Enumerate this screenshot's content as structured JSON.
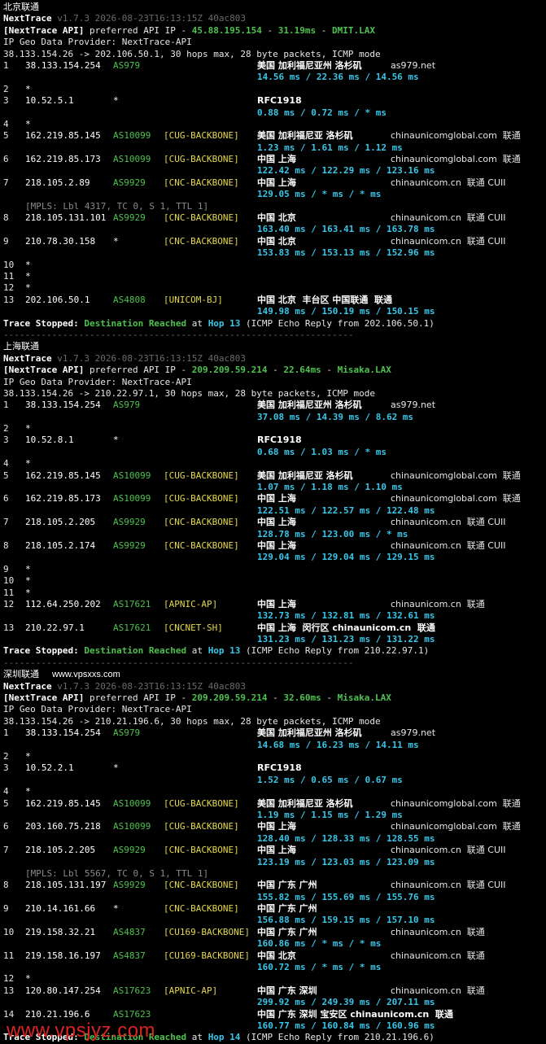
{
  "sections": [
    {
      "title": "北京联通",
      "site": "",
      "version_line": {
        "app": "NextTrace",
        "meta": "v1.7.3 2026-08-23T16:13:15Z 40ac803"
      },
      "api_line": {
        "prefix": "[NextTrace API]",
        "text": " preferred API IP - ",
        "ip": "45.88.195.154",
        "dash": " - ",
        "ms": "31.19ms",
        "dash2": " - ",
        "node": "DMIT.LAX"
      },
      "geo_provider": "IP Geo Data Provider: NextTrace-API",
      "route_line": "38.133.154.26 -> 202.106.50.1, 30 hops max, 28 byte packets, ICMP mode",
      "hops": [
        {
          "n": "1",
          "ip": "38.133.154.254",
          "as": "AS979",
          "tag": "",
          "geo": "美国 加利福尼亚州 洛杉矶",
          "dom": "as979.net",
          "rtt": "14.56 ms / 22.36 ms / 14.56 ms"
        },
        {
          "n": "2",
          "ip": "*"
        },
        {
          "n": "3",
          "ip": "10.52.5.1",
          "as": "*",
          "tag": "",
          "geo": "RFC1918",
          "dom": "",
          "rtt": "0.88 ms / 0.72 ms / * ms"
        },
        {
          "n": "4",
          "ip": "*"
        },
        {
          "n": "5",
          "ip": "162.219.85.145",
          "as": "AS10099",
          "tag": "[CUG-BACKBONE]",
          "geo": "美国 加利福尼亚 洛杉矶",
          "dom": "chinaunicomglobal.com  联通",
          "rtt": "1.23 ms / 1.61 ms / 1.12 ms"
        },
        {
          "n": "6",
          "ip": "162.219.85.173",
          "as": "AS10099",
          "tag": "[CUG-BACKBONE]",
          "geo": "中国 上海",
          "dom": "chinaunicomglobal.com  联通",
          "rtt": "122.42 ms / 122.29 ms / 123.16 ms"
        },
        {
          "n": "7",
          "ip": "218.105.2.89",
          "as": "AS9929",
          "tag": "[CNC-BACKBONE]",
          "geo": "中国 上海",
          "dom": "chinaunicom.cn  联通 CUII",
          "rtt": "129.05 ms / * ms / * ms"
        },
        {
          "n": "8",
          "ip": "218.105.131.101",
          "as": "AS9929",
          "tag": "[CNC-BACKBONE]",
          "geo": "中国 北京",
          "dom": "chinaunicom.cn  联通 CUII",
          "rtt": "163.40 ms / 163.41 ms / 163.78 ms",
          "mpls": "[MPLS: Lbl 4317, TC 0, S 1, TTL 1]"
        },
        {
          "n": "9",
          "ip": "210.78.30.158",
          "as": "*",
          "tag": "[CNC-BACKBONE]",
          "geo": "中国 北京",
          "dom": "chinaunicom.cn  联通 CUII",
          "rtt": "153.83 ms / 153.13 ms / 152.96 ms"
        },
        {
          "n": "10",
          "ip": "*"
        },
        {
          "n": "11",
          "ip": "*"
        },
        {
          "n": "12",
          "ip": "*"
        },
        {
          "n": "13",
          "ip": "202.106.50.1",
          "as": "AS4808",
          "tag": "[UNICOM-BJ]",
          "geo": "中国 北京  丰台区 中国联通  联通",
          "dom": "",
          "rtt": "149.98 ms / 150.19 ms / 150.15 ms"
        }
      ],
      "stop": {
        "a": "Trace Stopped: ",
        "b": "Destination Reached",
        "c": " at ",
        "d": "Hop 13",
        "e": " (ICMP Echo Reply from 202.106.50.1)"
      }
    },
    {
      "title": "上海联通",
      "site": "",
      "version_line": {
        "app": "NextTrace",
        "meta": "v1.7.3 2026-08-23T16:13:15Z 40ac803"
      },
      "api_line": {
        "prefix": "[NextTrace API]",
        "text": " preferred API IP - ",
        "ip": "209.209.59.214",
        "dash": " - ",
        "ms": "22.64ms",
        "dash2": " - ",
        "node": "Misaka.LAX"
      },
      "geo_provider": "IP Geo Data Provider: NextTrace-API",
      "route_line": "38.133.154.26 -> 210.22.97.1, 30 hops max, 28 byte packets, ICMP mode",
      "hops": [
        {
          "n": "1",
          "ip": "38.133.154.254",
          "as": "AS979",
          "tag": "",
          "geo": "美国 加利福尼亚州 洛杉矶",
          "dom": "as979.net",
          "rtt": "37.08 ms / 14.39 ms / 8.62 ms"
        },
        {
          "n": "2",
          "ip": "*"
        },
        {
          "n": "3",
          "ip": "10.52.8.1",
          "as": "*",
          "tag": "",
          "geo": "RFC1918",
          "dom": "",
          "rtt": "0.68 ms / 1.03 ms / * ms"
        },
        {
          "n": "4",
          "ip": "*"
        },
        {
          "n": "5",
          "ip": "162.219.85.145",
          "as": "AS10099",
          "tag": "[CUG-BACKBONE]",
          "geo": "美国 加利福尼亚 洛杉矶",
          "dom": "chinaunicomglobal.com  联通",
          "rtt": "1.07 ms / 1.18 ms / 1.10 ms"
        },
        {
          "n": "6",
          "ip": "162.219.85.173",
          "as": "AS10099",
          "tag": "[CUG-BACKBONE]",
          "geo": "中国 上海",
          "dom": "chinaunicomglobal.com  联通",
          "rtt": "122.51 ms / 122.57 ms / 122.48 ms"
        },
        {
          "n": "7",
          "ip": "218.105.2.205",
          "as": "AS9929",
          "tag": "[CNC-BACKBONE]",
          "geo": "中国 上海",
          "dom": "chinaunicom.cn  联通 CUII",
          "rtt": "128.78 ms / 123.00 ms / * ms"
        },
        {
          "n": "8",
          "ip": "218.105.2.174",
          "as": "AS9929",
          "tag": "[CNC-BACKBONE]",
          "geo": "中国 上海",
          "dom": "chinaunicom.cn  联通 CUII",
          "rtt": "129.04 ms / 129.04 ms / 129.15 ms"
        },
        {
          "n": "9",
          "ip": "*"
        },
        {
          "n": "10",
          "ip": "*"
        },
        {
          "n": "11",
          "ip": "*"
        },
        {
          "n": "12",
          "ip": "112.64.250.202",
          "as": "AS17621",
          "tag": "[APNIC-AP]",
          "geo": "中国 上海",
          "dom": "chinaunicom.cn  联通",
          "rtt": "132.73 ms / 132.81 ms / 132.61 ms"
        },
        {
          "n": "13",
          "ip": "210.22.97.1",
          "as": "AS17621",
          "tag": "[CNCNET-SH]",
          "geo": "中国 上海  闵行区 chinaunicom.cn  联通",
          "dom": "",
          "rtt": "131.23 ms / 131.23 ms / 131.22 ms"
        }
      ],
      "stop": {
        "a": "Trace Stopped: ",
        "b": "Destination Reached",
        "c": " at ",
        "d": "Hop 13",
        "e": " (ICMP Echo Reply from 210.22.97.1)"
      }
    },
    {
      "title": "深圳联通",
      "site": "www.vpsxxs.com",
      "version_line": {
        "app": "NextTrace",
        "meta": "v1.7.3 2026-08-23T16:13:15Z 40ac803"
      },
      "api_line": {
        "prefix": "[NextTrace API]",
        "text": " preferred API IP - ",
        "ip": "209.209.59.214",
        "dash": " - ",
        "ms": "32.60ms",
        "dash2": " - ",
        "node": "Misaka.LAX"
      },
      "geo_provider": "IP Geo Data Provider: NextTrace-API",
      "route_line": "38.133.154.26 -> 210.21.196.6, 30 hops max, 28 byte packets, ICMP mode",
      "hops": [
        {
          "n": "1",
          "ip": "38.133.154.254",
          "as": "AS979",
          "tag": "",
          "geo": "美国 加利福尼亚州 洛杉矶",
          "dom": "as979.net",
          "rtt": "14.68 ms / 16.23 ms / 14.11 ms"
        },
        {
          "n": "2",
          "ip": "*"
        },
        {
          "n": "3",
          "ip": "10.52.2.1",
          "as": "*",
          "tag": "",
          "geo": "RFC1918",
          "dom": "",
          "rtt": "1.52 ms / 0.65 ms / 0.67 ms"
        },
        {
          "n": "4",
          "ip": "*"
        },
        {
          "n": "5",
          "ip": "162.219.85.145",
          "as": "AS10099",
          "tag": "[CUG-BACKBONE]",
          "geo": "美国 加利福尼亚 洛杉矶",
          "dom": "chinaunicomglobal.com  联通",
          "rtt": "1.19 ms / 1.15 ms / 1.29 ms"
        },
        {
          "n": "6",
          "ip": "203.160.75.218",
          "as": "AS10099",
          "tag": "[CUG-BACKBONE]",
          "geo": "中国 上海",
          "dom": "chinaunicomglobal.com  联通",
          "rtt": "128.40 ms / 128.33 ms / 128.55 ms"
        },
        {
          "n": "7",
          "ip": "218.105.2.205",
          "as": "AS9929",
          "tag": "[CNC-BACKBONE]",
          "geo": "中国 上海",
          "dom": "chinaunicom.cn  联通 CUII",
          "rtt": "123.19 ms / 123.03 ms / 123.09 ms"
        },
        {
          "n": "8",
          "ip": "218.105.131.197",
          "as": "AS9929",
          "tag": "[CNC-BACKBONE]",
          "geo": "中国 广东 广州",
          "dom": "chinaunicom.cn  联通 CUII",
          "rtt": "155.82 ms / 155.69 ms / 155.76 ms",
          "mpls": "[MPLS: Lbl 5567, TC 0, S 1, TTL 1]"
        },
        {
          "n": "9",
          "ip": "210.14.161.66",
          "as": "*",
          "tag": "[CNC-BACKBONE]",
          "geo": "中国 广东 广州",
          "dom": "",
          "rtt": "156.88 ms / 159.15 ms / 157.10 ms"
        },
        {
          "n": "10",
          "ip": "219.158.32.21",
          "as": "AS4837",
          "tag": "[CU169-BACKBONE]",
          "geo": "中国 广东 广州",
          "dom": "chinaunicom.cn  联通",
          "rtt": "160.86 ms / * ms / * ms"
        },
        {
          "n": "11",
          "ip": "219.158.16.197",
          "as": "AS4837",
          "tag": "[CU169-BACKBONE]",
          "geo": "中国 北京",
          "dom": "chinaunicom.cn  联通",
          "rtt": "160.72 ms / * ms / * ms"
        },
        {
          "n": "12",
          "ip": "*"
        },
        {
          "n": "13",
          "ip": "120.80.147.254",
          "as": "AS17623",
          "tag": "[APNIC-AP]",
          "geo": "中国 广东 深圳",
          "dom": "chinaunicom.cn  联通",
          "rtt": "299.92 ms / 249.39 ms / 207.11 ms"
        },
        {
          "n": "14",
          "ip": "210.21.196.6",
          "as": "AS17623",
          "tag": "",
          "geo": "中国 广东 深圳 宝安区 chinaunicom.cn  联通",
          "dom": "",
          "rtt": "160.77 ms / 160.84 ms / 160.96 ms"
        }
      ],
      "stop": {
        "a": "Trace Stopped: ",
        "b": "Destination Reached",
        "c": " at ",
        "d": "Hop 14",
        "e": " (ICMP Echo Reply from 210.21.196.6)"
      }
    }
  ],
  "separator": "-----------------------------------------------------------------",
  "watermark": "www.vpsjyz.com"
}
